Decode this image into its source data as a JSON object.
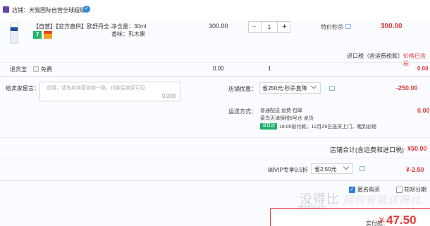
{
  "shop": {
    "label": "店铺：天猫国际自营全球超级",
    "chat_glyph": "✓"
  },
  "item": {
    "title": "【自营】【官方直供】欧舒丹全...",
    "spec_volume": "净含量：30ml",
    "spec_scent": "香味：乳木果",
    "badge_7": "7",
    "unit_price": "300.00",
    "quantity": "1",
    "minus": "−",
    "plus": "+",
    "promo": "特价秒杀",
    "subtotal": "300.00",
    "tax_note": "进口税（含运费税款）",
    "tax_link": "价格已含税"
  },
  "insurance": {
    "label": "退货宝",
    "check_glyph": "✓",
    "free": "免费",
    "price": "0.00",
    "qty": "1",
    "total": "0.00"
  },
  "message": {
    "label": "给卖家留言：",
    "placeholder": "选填，请先和商家协商一致，付款后商家可见",
    "count": "0/200"
  },
  "shop_discount": {
    "label": "店铺优惠：",
    "selected": "省250元:秒杀直降",
    "amount": "-250.00"
  },
  "shipping": {
    "label": "运送方式：",
    "line1": "普通配送 运费 包邮",
    "line2": "菜鸟天津保税6号仓  发货",
    "badge": "当日达",
    "eta": "18:00前付款，12月29日送货上门，晚到必赔",
    "price": "0.00"
  },
  "shop_total": {
    "label": "店铺合计(含运费和进口税)",
    "value": "¥50.00"
  },
  "vip": {
    "label": "88VIP专享9.5折",
    "selected": "省2.50元",
    "amount": "¥-2.50"
  },
  "options": {
    "anonymous": "匿名购买",
    "huabei": "花呗分期",
    "anon_glyph": "✓"
  },
  "watermark": {
    "main": "没得比",
    "sub": "网购有我该得比",
    "url": "Meidebi.com"
  },
  "payment": {
    "label": "实付款：",
    "yen": "¥",
    "value": "47.50"
  },
  "colors": {
    "accent_red": "#e4393c",
    "blue": "#2f7de1",
    "green": "#1db46a"
  }
}
